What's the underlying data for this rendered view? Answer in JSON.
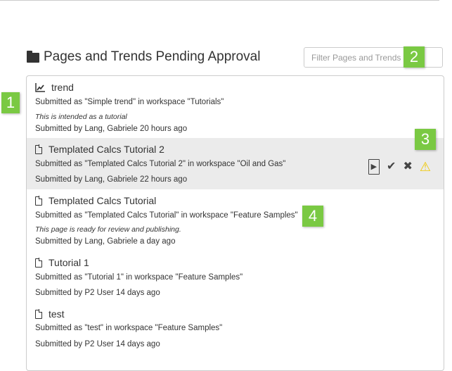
{
  "header": {
    "title": "Pages and Trends Pending Approval",
    "filter_placeholder": "Filter Pages and Trends"
  },
  "items": [
    {
      "type": "trend",
      "name": "trend",
      "submitted_as": "Submitted as \"Simple trend\" in workspace \"Tutorials\"",
      "note": "This is intended as a tutorial",
      "submitted_by": "Submitted by Lang, Gabriele 20 hours ago"
    },
    {
      "type": "page",
      "name": "Templated Calcs Tutorial 2",
      "submitted_as": "Submitted as \"Templated Calcs Tutorial 2\" in workspace \"Oil and Gas\"",
      "note": "",
      "submitted_by": "Submitted by Lang, Gabriele 22 hours ago"
    },
    {
      "type": "page",
      "name": "Templated Calcs Tutorial",
      "submitted_as": "Submitted as \"Templated Calcs Tutorial\" in workspace \"Feature Samples\"",
      "note": "This page is ready for review and publishing.",
      "submitted_by": "Submitted by Lang, Gabriele a day ago"
    },
    {
      "type": "page",
      "name": "Tutorial 1",
      "submitted_as": "Submitted as \"Tutorial 1\" in workspace \"Feature Samples\"",
      "note": "",
      "submitted_by": "Submitted by P2 User 14 days ago"
    },
    {
      "type": "page",
      "name": "test",
      "submitted_as": "Submitted as \"test\" in workspace \"Feature Samples\"",
      "note": "",
      "submitted_by": "Submitted by P2 User 14 days ago"
    }
  ],
  "actions": {
    "preview": "▶",
    "approve": "✔",
    "reject": "✖",
    "warning": "⚠"
  },
  "badges": [
    "1",
    "2",
    "3",
    "4"
  ],
  "colors": {
    "badge": "#7ac943",
    "highlight": "#ebebeb",
    "warning": "#f0c800"
  }
}
